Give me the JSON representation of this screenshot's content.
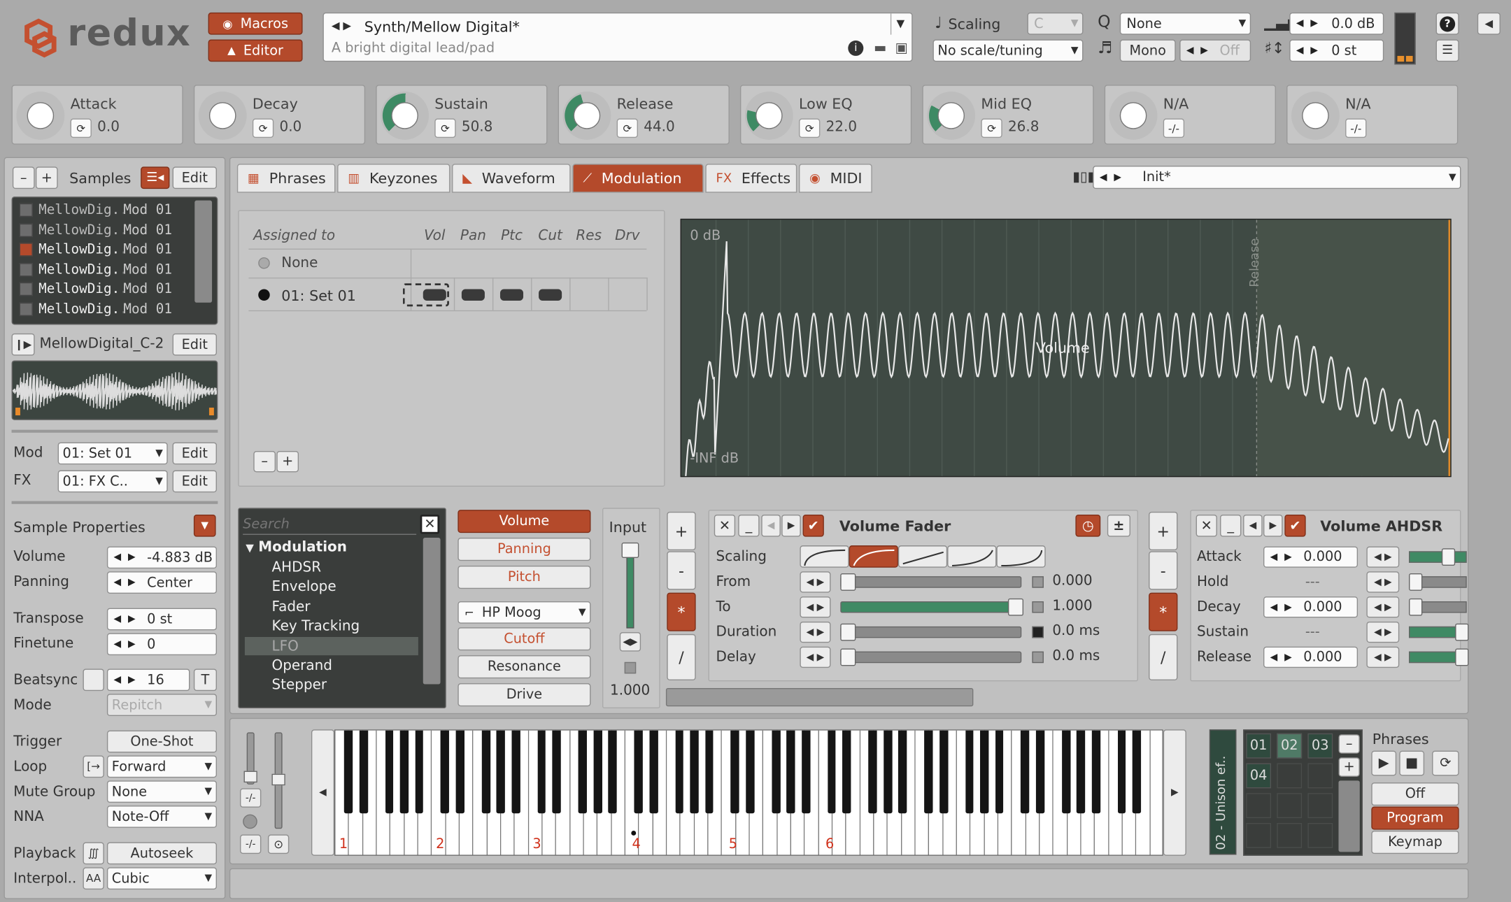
{
  "logo": "redux",
  "header": {
    "macros": "Macros",
    "editor": "Editor",
    "preset_name": "Synth/Mellow Digital*",
    "preset_desc": "A bright digital lead/pad",
    "scaling_label": "Scaling",
    "scaling_key": "C",
    "scale_tuning": "No scale/tuning",
    "quantize": "None",
    "mono": "Mono",
    "off": "Off",
    "volume_db": "0.0 dB",
    "transpose_st": "0 st",
    "help": "?"
  },
  "macros": [
    {
      "name": "Attack",
      "value": "0.0",
      "level": 0
    },
    {
      "name": "Decay",
      "value": "0.0",
      "level": 0
    },
    {
      "name": "Sustain",
      "value": "50.8",
      "level": 0.508
    },
    {
      "name": "Release",
      "value": "44.0",
      "level": 0.44
    },
    {
      "name": "Low EQ",
      "value": "22.0",
      "level": 0.22
    },
    {
      "name": "Mid EQ",
      "value": "26.8",
      "level": 0.268
    },
    {
      "name": "N/A",
      "value": "",
      "level": 0
    },
    {
      "name": "N/A",
      "value": "",
      "level": 0
    }
  ],
  "samples": {
    "minus": "–",
    "plus": "+",
    "title": "Samples",
    "edit": "Edit",
    "items": [
      {
        "name": "MellowDig..",
        "mod": "Mod 01",
        "active": false
      },
      {
        "name": "MellowDig..",
        "mod": "Mod 01",
        "active": false
      },
      {
        "name": "MellowDig..",
        "mod": "Mod 01",
        "active": true
      },
      {
        "name": "MellowDig..",
        "mod": "Mod 01",
        "active": false
      },
      {
        "name": "MellowDig..",
        "mod": "Mod 01",
        "active": false
      },
      {
        "name": "MellowDig..",
        "mod": "Mod 01",
        "active": false
      }
    ],
    "current": "MellowDigital_C-2",
    "current_edit": "Edit"
  },
  "mod_select": {
    "label": "Mod",
    "value": "01: Set 01",
    "edit": "Edit"
  },
  "fx_select": {
    "label": "FX",
    "value": "01: FX C..",
    "edit": "Edit"
  },
  "sample_props": {
    "title": "Sample Properties",
    "volume_label": "Volume",
    "volume": "-4.883 dB",
    "panning_label": "Panning",
    "panning": "Center",
    "transpose_label": "Transpose",
    "transpose": "0 st",
    "finetune_label": "Finetune",
    "finetune": "0",
    "beatsync_label": "Beatsync",
    "beatsync": "16",
    "beatsync_t": "T",
    "mode_label": "Mode",
    "mode": "Repitch",
    "trigger_label": "Trigger",
    "trigger": "One-Shot",
    "loop_label": "Loop",
    "loop": "Forward",
    "mute_label": "Mute Group",
    "mute": "None",
    "nna_label": "NNA",
    "nna": "Note-Off",
    "playback_label": "Playback",
    "playback": "Autoseek",
    "interp_label": "Interpol..",
    "interp": "Cubic"
  },
  "tabs": [
    {
      "label": "Phrases",
      "icon": "▦"
    },
    {
      "label": "Keyzones",
      "icon": "▥"
    },
    {
      "label": "Waveform",
      "icon": "◣"
    },
    {
      "label": "Modulation",
      "icon": "⟋"
    },
    {
      "label": "Effects",
      "icon": "FX"
    },
    {
      "label": "MIDI",
      "icon": "◉"
    }
  ],
  "modset": {
    "value": "Init*"
  },
  "assign": {
    "header": "Assigned to",
    "cols": [
      "Vol",
      "Pan",
      "Ptc",
      "Cut",
      "Res",
      "Drv"
    ],
    "none": "None",
    "set": "01: Set 01",
    "minus": "–",
    "plus": "+"
  },
  "graph": {
    "top_label": "0 dB",
    "bottom_label": "-INF dB",
    "center_label": "Volume",
    "release_label": "Release"
  },
  "devices": {
    "search_placeholder": "Search",
    "group": "Modulation",
    "items": [
      "AHDSR",
      "Envelope",
      "Fader",
      "Key Tracking",
      "LFO",
      "Operand",
      "Stepper"
    ]
  },
  "targets": {
    "volume": "Volume",
    "panning": "Panning",
    "pitch": "Pitch",
    "filter": "HP Moog",
    "cutoff": "Cutoff",
    "resonance": "Resonance",
    "drive": "Drive"
  },
  "input": {
    "label": "Input",
    "value": "1.000"
  },
  "ops": [
    "+",
    "-",
    "*",
    "/"
  ],
  "fader": {
    "title": "Volume Fader",
    "scaling": "Scaling",
    "from": "From",
    "from_val": "0.000",
    "to": "To",
    "to_val": "1.000",
    "duration": "Duration",
    "duration_val": "0.0 ms",
    "delay": "Delay",
    "delay_val": "0.0 ms"
  },
  "ahdsr": {
    "title": "Volume AHDSR",
    "attack": "Attack",
    "attack_val": "0.000",
    "hold": "Hold",
    "hold_val": "---",
    "decay": "Decay",
    "decay_val": "0.000",
    "sustain": "Sustain",
    "sustain_val": "---",
    "release": "Release",
    "release_val": "0.000"
  },
  "keyboard": {
    "octaves": [
      "1",
      "2",
      "3",
      "4",
      "5",
      "6"
    ]
  },
  "phrases": {
    "vertical_label": "02 - Unison ef..",
    "slots": [
      "01",
      "02",
      "03",
      "04"
    ],
    "title": "Phrases",
    "off": "Off",
    "program": "Program",
    "keymap": "Keymap"
  },
  "colors": {
    "accent": "#b44a2b",
    "macro_green": "#3e8a64",
    "graph_bg": "#3f4a44"
  }
}
